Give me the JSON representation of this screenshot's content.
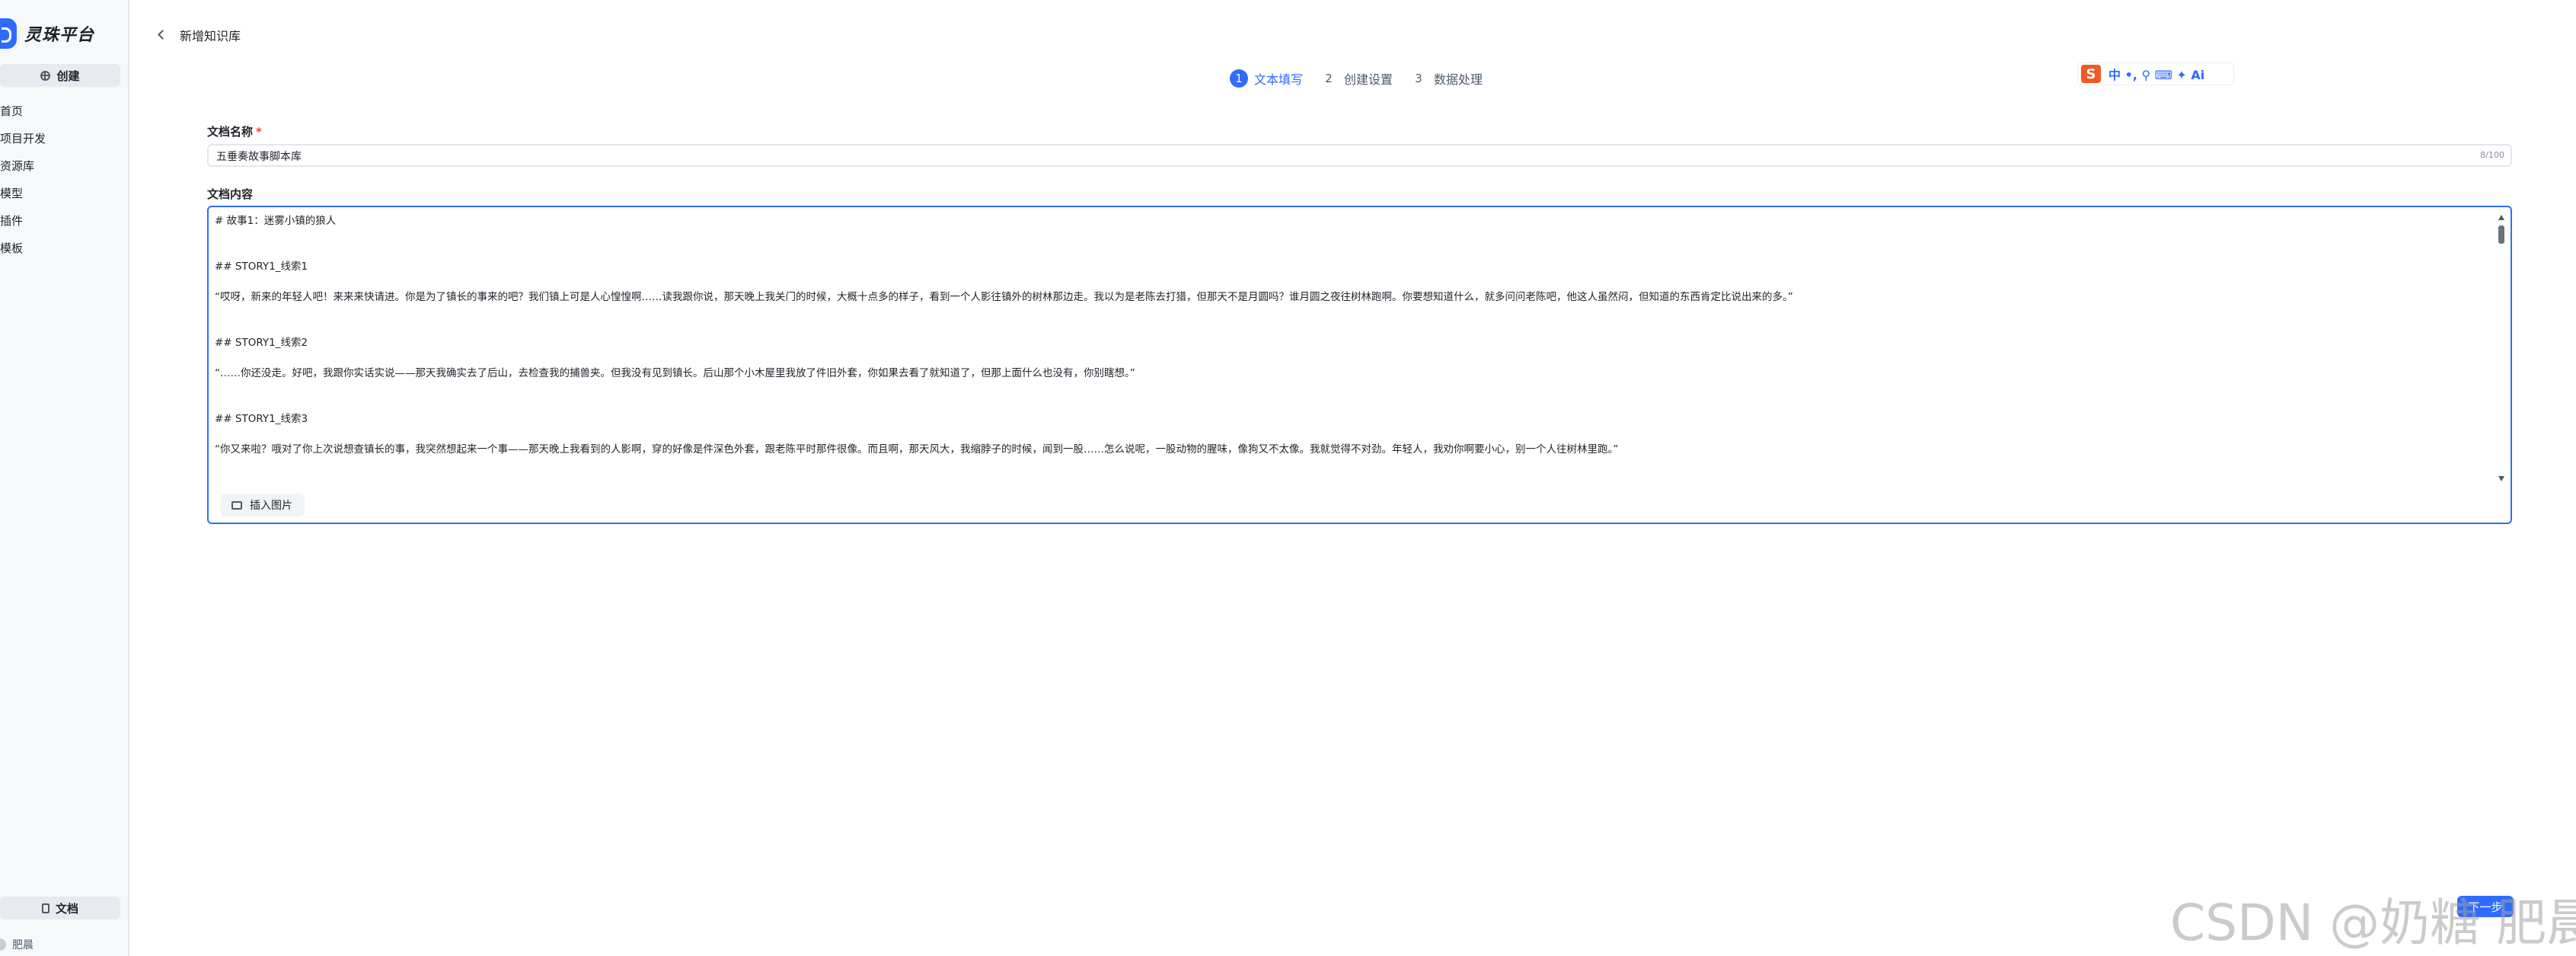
{
  "sidebar": {
    "logo_text": "灵珠平台",
    "create_label": "创建",
    "items": [
      {
        "label": "首页"
      },
      {
        "label": "项目开发"
      },
      {
        "label": "资源库"
      },
      {
        "label": "模型"
      },
      {
        "label": "插件"
      },
      {
        "label": "模板"
      }
    ],
    "docs_label": "文档",
    "user_name": "肥晨"
  },
  "header": {
    "title": "新增知识库"
  },
  "steps": [
    {
      "num": "1",
      "label": "文本填写"
    },
    {
      "num": "2",
      "label": "创建设置"
    },
    {
      "num": "3",
      "label": "数据处理"
    }
  ],
  "ime_toolbar": {
    "logo": "S",
    "glyphs": "中 •, ⚲ ⌨ ✦ Ai"
  },
  "form": {
    "name_label": "文档名称",
    "required_mark": "*",
    "name_value": "五垂奏故事脚本库",
    "name_count": "8/100",
    "content_label": "文档内容",
    "content_lines": [
      "# 故事1：迷雾小镇的狼人",
      "## STORY1_线索1",
      "“哎呀，新来的年轻人吧！来来来快请进。你是为了镇长的事来的吧？我们镇上可是人心惶惶啊……读我跟你说，那天晚上我关门的时候，大概十点多的样子，看到一个人影往镇外的树林那边走。我以为是老陈去打猎，但那天不是月圆吗？谁月圆之夜往树林跑啊。你要想知道什么，就多问问老陈吧，他这人虽然闷，但知道的东西肯定比说出来的多。”",
      "## STORY1_线索2",
      "“……你还没走。好吧，我跟你实话实说——那天我确实去了后山，去检查我的捕兽夹。但我没有见到镇长。后山那个小木屋里我放了件旧外套，你如果去看了就知道了，但那上面什么也没有，你别瞎想。”",
      "## STORY1_线索3",
      "“你又来啦？哦对了你上次说想查镇长的事，我突然想起来一个事——那天晚上我看到的人影啊，穿的好像是件深色外套，跟老陈平时那件很像。而且啊，那天风大，我缩脖子的时候，闻到一股……怎么说呢，一股动物的腥味，像狗又不太像。我就觉得不对劲。年轻人，我劝你啊要小心，别一个人往树林里跑。”"
    ],
    "insert_image_label": "插入图片"
  },
  "footer": {
    "next_label": "下一步",
    "watermark": "CSDN @奶糖 肥晨"
  }
}
